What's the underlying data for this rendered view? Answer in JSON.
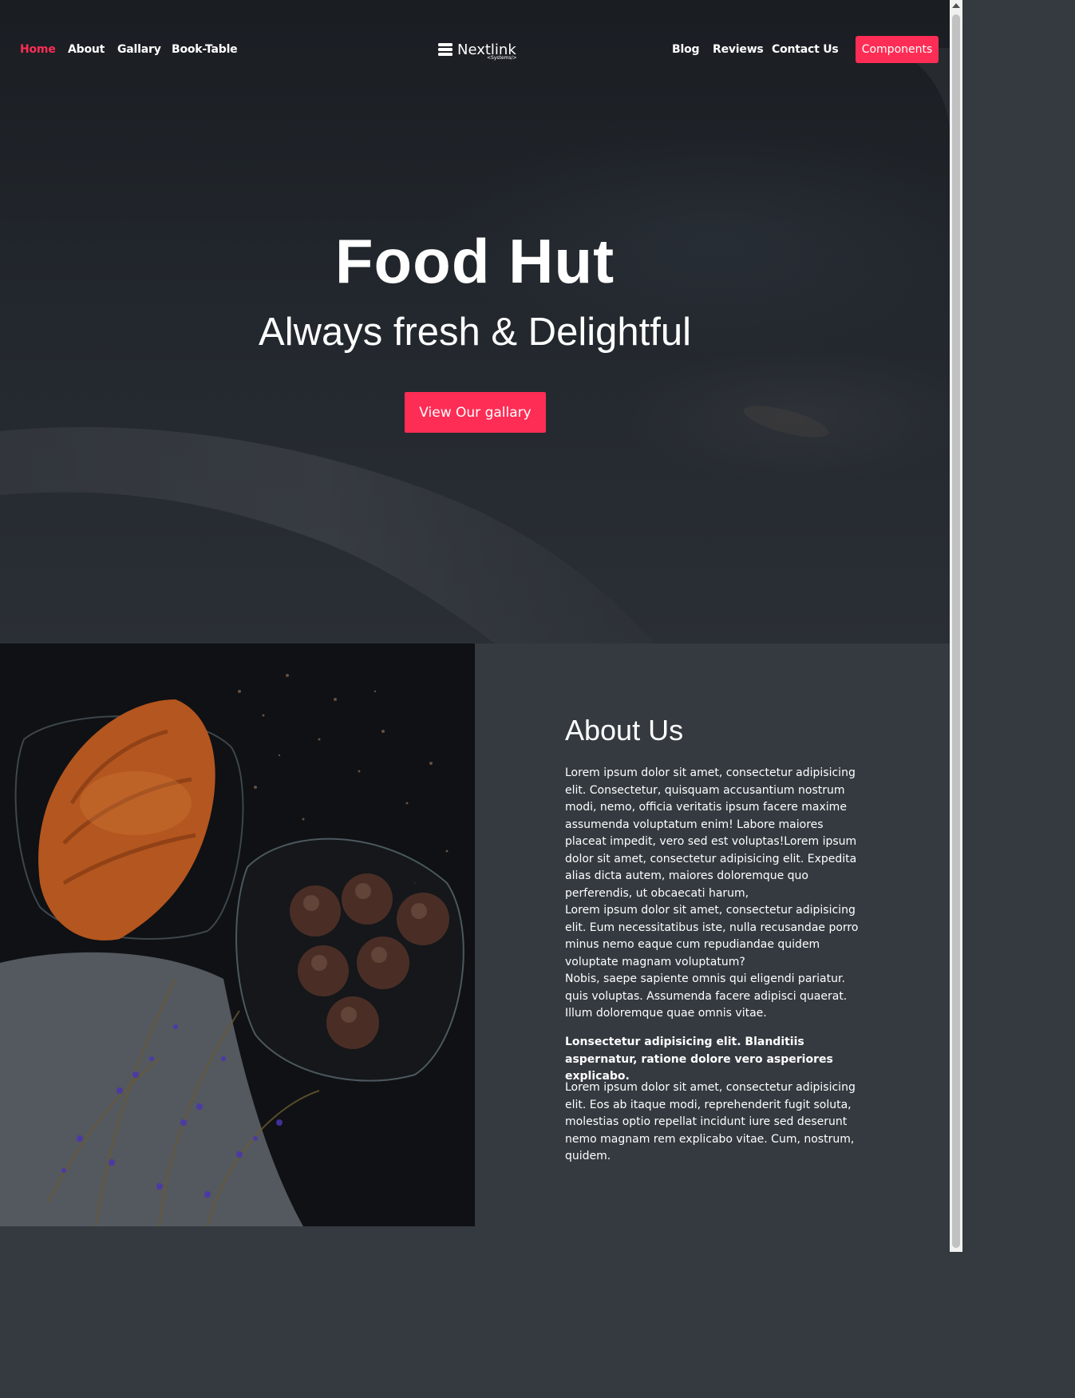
{
  "nav": {
    "left": [
      {
        "label": "Home",
        "active": true
      },
      {
        "label": "About"
      },
      {
        "label": "Gallary"
      },
      {
        "label": "Book-Table"
      }
    ],
    "right": [
      {
        "label": "Blog"
      },
      {
        "label": "Reviews"
      },
      {
        "label": "Contact Us"
      }
    ],
    "components_label": "Components"
  },
  "brand": {
    "name": "Nextlink",
    "tagline": "<Systems/>"
  },
  "hero": {
    "title": "Food Hut",
    "subtitle": "Always fresh & Delightful",
    "button_label": "View Our gallary"
  },
  "about": {
    "title": "About Us",
    "p1": "Lorem ipsum dolor sit amet, consectetur adipisicing elit. Consectetur, quisquam accusantium nostrum modi, nemo, officia veritatis ipsum facere maxime assumenda voluptatum enim! Labore maiores placeat impedit, vero sed est voluptas!Lorem ipsum dolor sit amet, consectetur adipisicing elit. Expedita alias dicta autem, maiores doloremque quo perferendis, ut obcaecati harum,",
    "p2": "Lorem ipsum dolor sit amet, consectetur adipisicing elit. Eum necessitatibus iste, nulla recusandae porro minus nemo eaque cum repudiandae quidem voluptate magnam voluptatum?",
    "p3": "Nobis, saepe sapiente omnis qui eligendi pariatur. quis voluptas. Assumenda facere adipisci quaerat. Illum doloremque quae omnis vitae.",
    "p4_bold": "Lonsectetur adipisicing elit. Blanditiis aspernatur, ratione dolore vero asperiores explicabo.",
    "p5": "Lorem ipsum dolor sit amet, consectetur adipisicing elit. Eos ab itaque modi, reprehenderit fugit soluta, molestias optio repellat incidunt iure sed deserunt nemo magnam rem explicabo vitae. Cum, nostrum, quidem."
  },
  "colors": {
    "accent": "#fe2d55",
    "dark_panel": "#343a40",
    "hero_bg": "#1a1d22"
  }
}
